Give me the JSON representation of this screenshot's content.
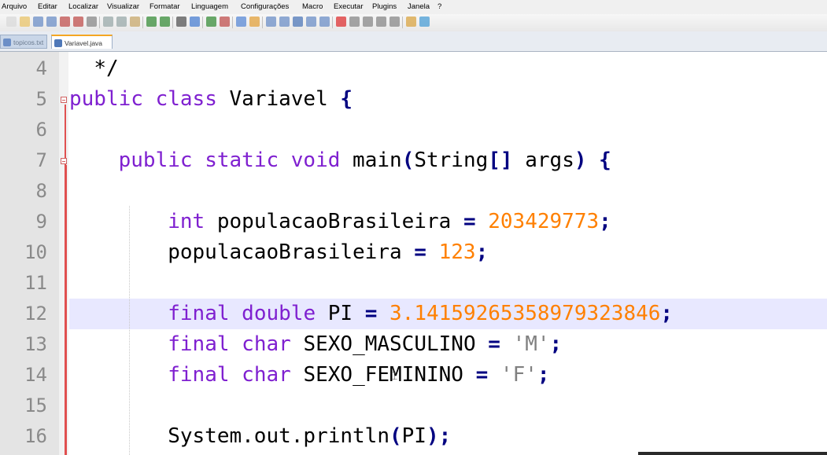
{
  "menu": [
    "Arquivo",
    "Editar",
    "Localizar",
    "Visualizar",
    "Formatar",
    "Linguagem",
    "Configurações",
    "Macro",
    "Executar",
    "Plugins",
    "Janela",
    "?"
  ],
  "toolbar": {
    "buttons": [
      "new-file-icon",
      "open-file-icon",
      "save-icon",
      "save-all-icon",
      "close-icon",
      "close-all-icon",
      "print-icon",
      "cut-icon",
      "copy-icon",
      "paste-icon",
      "undo-icon",
      "redo-icon",
      "find-icon",
      "replace-icon",
      "zoom-in-icon",
      "zoom-out-icon",
      "sync-v-icon",
      "sync-h-icon",
      "wrap-icon",
      "show-all-icon",
      "indent-guide-icon",
      "doc-map-icon",
      "function-list-icon",
      "record-macro-icon",
      "stop-macro-icon",
      "play-macro-icon",
      "play-multiple-icon",
      "save-macro-icon",
      "spell-check-icon",
      "compare-icon"
    ]
  },
  "tabs": [
    {
      "label": "topicos.txt",
      "active": false,
      "icon": "file-icon"
    },
    {
      "label": "Variavel.java",
      "active": true,
      "icon": "file-icon"
    }
  ],
  "editor": {
    "line_numbers": [
      "4",
      "5",
      "6",
      "7",
      "8",
      "9",
      "10",
      "11",
      "12",
      "13",
      "14",
      "15",
      "16"
    ],
    "highlighted_line": "12",
    "colors": {
      "keyword": "#7f20d0",
      "number": "#ff8000",
      "char": "#808080",
      "operator": "#000080",
      "gutter": "#e4e4e4",
      "fold_marker": "#e05050",
      "current_line": "#e8e8ff"
    },
    "lines": [
      {
        "num": "4",
        "tokens": [
          {
            "t": "  ",
            "c": "plain"
          },
          {
            "t": "*/",
            "c": "plain"
          }
        ]
      },
      {
        "num": "5",
        "tokens": [
          {
            "t": "public",
            "c": "kw"
          },
          {
            "t": " ",
            "c": "plain"
          },
          {
            "t": "class",
            "c": "kw"
          },
          {
            "t": " Variavel ",
            "c": "plain"
          },
          {
            "t": "{",
            "c": "op"
          }
        ]
      },
      {
        "num": "6",
        "tokens": []
      },
      {
        "num": "7",
        "tokens": [
          {
            "t": "    ",
            "c": "plain"
          },
          {
            "t": "public",
            "c": "kw"
          },
          {
            "t": " ",
            "c": "plain"
          },
          {
            "t": "static",
            "c": "kw"
          },
          {
            "t": " ",
            "c": "plain"
          },
          {
            "t": "void",
            "c": "kw"
          },
          {
            "t": " main",
            "c": "plain"
          },
          {
            "t": "(",
            "c": "op"
          },
          {
            "t": "String",
            "c": "plain"
          },
          {
            "t": "[]",
            "c": "op"
          },
          {
            "t": " args",
            "c": "plain"
          },
          {
            "t": ")",
            "c": "op"
          },
          {
            "t": " ",
            "c": "plain"
          },
          {
            "t": "{",
            "c": "op"
          }
        ]
      },
      {
        "num": "8",
        "tokens": []
      },
      {
        "num": "9",
        "tokens": [
          {
            "t": "        ",
            "c": "plain"
          },
          {
            "t": "int",
            "c": "kw"
          },
          {
            "t": " populacaoBrasileira ",
            "c": "plain"
          },
          {
            "t": "=",
            "c": "op"
          },
          {
            "t": " ",
            "c": "plain"
          },
          {
            "t": "203429773",
            "c": "num"
          },
          {
            "t": ";",
            "c": "op"
          }
        ]
      },
      {
        "num": "10",
        "tokens": [
          {
            "t": "        populacaoBrasileira ",
            "c": "plain"
          },
          {
            "t": "=",
            "c": "op"
          },
          {
            "t": " ",
            "c": "plain"
          },
          {
            "t": "123",
            "c": "num"
          },
          {
            "t": ";",
            "c": "op"
          }
        ]
      },
      {
        "num": "11",
        "tokens": []
      },
      {
        "num": "12",
        "tokens": [
          {
            "t": "        ",
            "c": "plain"
          },
          {
            "t": "final",
            "c": "kw"
          },
          {
            "t": " ",
            "c": "plain"
          },
          {
            "t": "double",
            "c": "kw"
          },
          {
            "t": " PI ",
            "c": "plain"
          },
          {
            "t": "=",
            "c": "op"
          },
          {
            "t": " ",
            "c": "plain"
          },
          {
            "t": "3.14159265358979323846",
            "c": "num"
          },
          {
            "t": ";",
            "c": "op"
          }
        ]
      },
      {
        "num": "13",
        "tokens": [
          {
            "t": "        ",
            "c": "plain"
          },
          {
            "t": "final",
            "c": "kw"
          },
          {
            "t": " ",
            "c": "plain"
          },
          {
            "t": "char",
            "c": "kw"
          },
          {
            "t": " SEXO_MASCULINO ",
            "c": "plain"
          },
          {
            "t": "=",
            "c": "op"
          },
          {
            "t": " ",
            "c": "plain"
          },
          {
            "t": "'M'",
            "c": "chr"
          },
          {
            "t": ";",
            "c": "op"
          }
        ]
      },
      {
        "num": "14",
        "tokens": [
          {
            "t": "        ",
            "c": "plain"
          },
          {
            "t": "final",
            "c": "kw"
          },
          {
            "t": " ",
            "c": "plain"
          },
          {
            "t": "char",
            "c": "kw"
          },
          {
            "t": " SEXO_FEMININO ",
            "c": "plain"
          },
          {
            "t": "=",
            "c": "op"
          },
          {
            "t": " ",
            "c": "plain"
          },
          {
            "t": "'F'",
            "c": "chr"
          },
          {
            "t": ";",
            "c": "op"
          }
        ]
      },
      {
        "num": "15",
        "tokens": []
      },
      {
        "num": "16",
        "tokens": [
          {
            "t": "        System.out.println",
            "c": "plain"
          },
          {
            "t": "(",
            "c": "op"
          },
          {
            "t": "PI",
            "c": "plain"
          },
          {
            "t": ")",
            "c": "op"
          },
          {
            "t": ";",
            "c": "op"
          }
        ]
      }
    ]
  }
}
